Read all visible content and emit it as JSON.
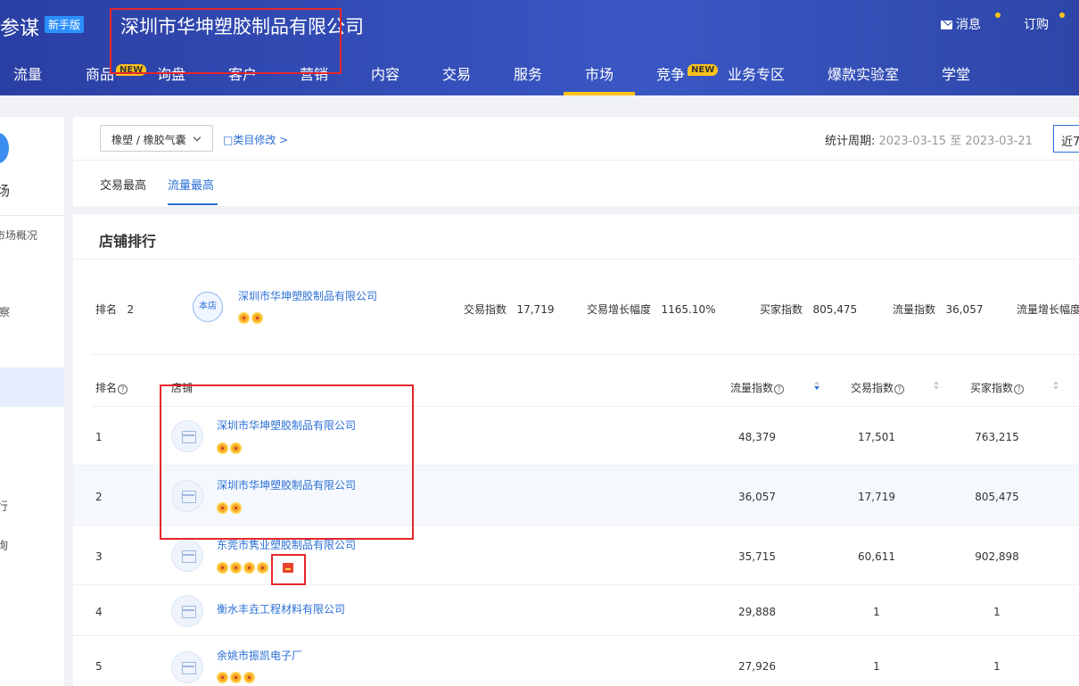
{
  "header": {
    "brand": "参谋",
    "brand_badge": "新手版",
    "shop_name": "深圳市华坤塑胶制品有限公司",
    "messages_label": "消息",
    "subscribe_label": "订购",
    "nav": [
      {
        "label": "流量"
      },
      {
        "label": "商品",
        "badge": "NEW"
      },
      {
        "label": "询盘"
      },
      {
        "label": "客户"
      },
      {
        "label": "营销"
      },
      {
        "label": "内容"
      },
      {
        "label": "交易"
      },
      {
        "label": "服务"
      },
      {
        "label": "市场",
        "active": true
      },
      {
        "label": "竞争",
        "badge": "NEW"
      },
      {
        "label": "业务专区"
      },
      {
        "label": "爆款实验室"
      },
      {
        "label": "学堂"
      }
    ]
  },
  "sidebar": {
    "items": [
      "场",
      "市场概况",
      "察",
      "行",
      "询"
    ]
  },
  "filter": {
    "category": "橡塑 / 橡胶气囊",
    "category_edit": "□类目修改 >",
    "period_label": "统计周期:",
    "period_value": "2023-03-15 至 2023-03-21",
    "recent_button": "近7"
  },
  "tabs": [
    {
      "label": "交易最高",
      "active": false
    },
    {
      "label": "流量最高",
      "active": true
    }
  ],
  "ranking": {
    "title": "店铺排行",
    "own_shop": {
      "rank_label": "排名",
      "rank": "2",
      "badge": "本店",
      "name": "深圳市华坤塑胶制品有限公司",
      "crowns": 2,
      "metrics": [
        {
          "label": "交易指数",
          "value": "17,719"
        },
        {
          "label": "交易增长幅度",
          "value": "1165.10%"
        },
        {
          "label": "买家指数",
          "value": "805,475"
        },
        {
          "label": "流量指数",
          "value": "36,057"
        },
        {
          "label": "流量增长幅度",
          "value": ""
        }
      ]
    },
    "columns": {
      "rank": "排名",
      "shop": "店铺",
      "traffic": "流量指数",
      "trade": "交易指数",
      "buyers": "买家指数"
    },
    "rows": [
      {
        "rank": "1",
        "name": "深圳市华坤塑胶制品有限公司",
        "crowns": 2,
        "traffic": "48,379",
        "trade": "17,501",
        "buyers": "763,215"
      },
      {
        "rank": "2",
        "name": "深圳市华坤塑胶制品有限公司",
        "crowns": 2,
        "traffic": "36,057",
        "trade": "17,719",
        "buyers": "805,475"
      },
      {
        "rank": "3",
        "name": "东莞市隽业塑胶制品有限公司",
        "crowns": 4,
        "gift": true,
        "traffic": "35,715",
        "trade": "60,611",
        "buyers": "902,898"
      },
      {
        "rank": "4",
        "name": "衡水丰垚工程材料有限公司",
        "crowns": 0,
        "traffic": "29,888",
        "trade": "1",
        "buyers": "1"
      },
      {
        "rank": "5",
        "name": "余姚市振凯电子厂",
        "crowns": 3,
        "traffic": "27,926",
        "trade": "1",
        "buyers": "1"
      }
    ]
  }
}
